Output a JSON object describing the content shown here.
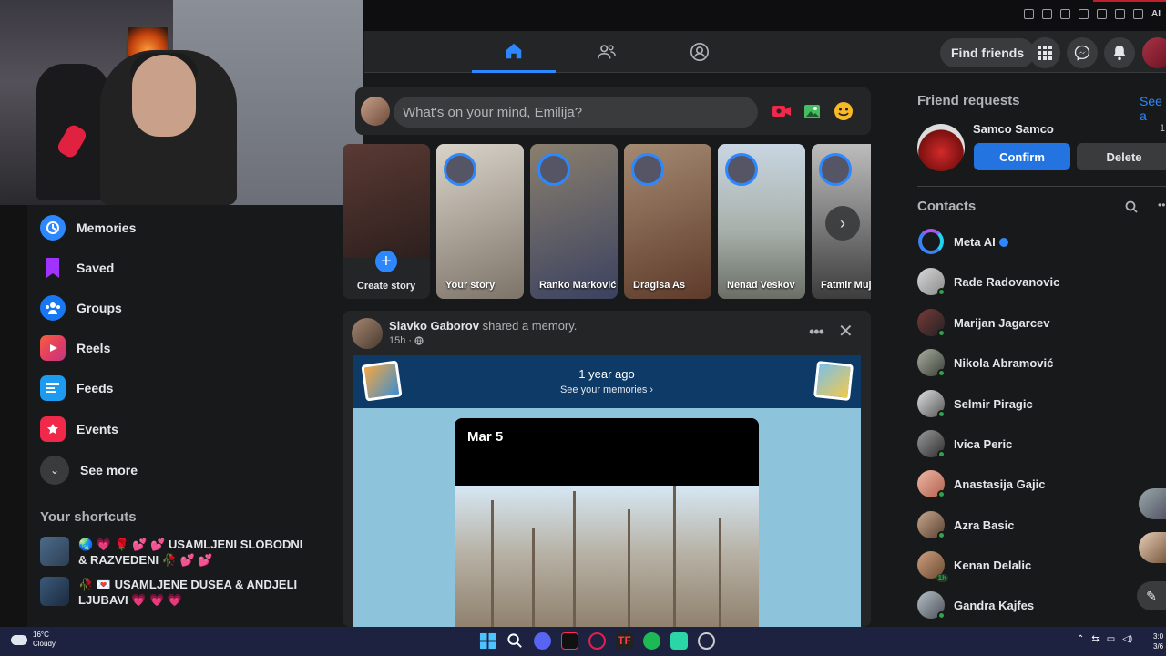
{
  "browser": {
    "extension_label": "AI"
  },
  "topnav": {
    "tabs": [
      {
        "id": "home",
        "icon": "home-icon",
        "active": true
      },
      {
        "id": "friends",
        "icon": "friends-icon",
        "active": false
      },
      {
        "id": "groups",
        "icon": "groups-icon",
        "active": false
      }
    ],
    "find_friends_label": "Find friends",
    "accent": "#2d88ff"
  },
  "sidebar": {
    "items": [
      {
        "label": "Memories",
        "icon": "clock-icon",
        "color": "#2d88ff"
      },
      {
        "label": "Saved",
        "icon": "bookmark-icon",
        "color": "#a033ff"
      },
      {
        "label": "Groups",
        "icon": "groups-icon",
        "color": "#1877f2"
      },
      {
        "label": "Reels",
        "icon": "reels-icon",
        "color": "#e4405f"
      },
      {
        "label": "Feeds",
        "icon": "feeds-icon",
        "color": "#1d9bf0"
      },
      {
        "label": "Events",
        "icon": "calendar-star-icon",
        "color": "#f02849"
      }
    ],
    "see_more_label": "See more",
    "shortcuts_title": "Your shortcuts",
    "shortcuts": [
      {
        "name": "🌏 💗 🌹 💕 💕 USAMLJENI SLOBODNI & RAZVEDENI 🥀 💕 💕"
      },
      {
        "name": "🥀 💌 USAMLJENE DUSEA & ANDJELI LJUBAVI 💗 💗 💗"
      }
    ]
  },
  "composer": {
    "placeholder": "What's on your mind, Emilija?"
  },
  "stories": {
    "create_label": "Create story",
    "items": [
      {
        "name": "Your story"
      },
      {
        "name": "Ranko Marković"
      },
      {
        "name": "Dragisa As"
      },
      {
        "name": "Nenad Veskov"
      },
      {
        "name": "Fatmir Mujo"
      }
    ]
  },
  "post": {
    "author": "Slavko Gaborov",
    "action": "shared a memory.",
    "time": "15h ·",
    "memory_title": "1 year ago",
    "memory_link": "See your memories ›",
    "card_date": "Mar 5"
  },
  "rightrail": {
    "friend_requests_title": "Friend requests",
    "see_all_label": "See a",
    "request": {
      "name": "Samco Samco",
      "count": "1",
      "confirm_label": "Confirm",
      "delete_label": "Delete"
    },
    "contacts_title": "Contacts",
    "contacts": [
      {
        "name": "Meta AI",
        "verified": true,
        "online": false
      },
      {
        "name": "Rade Radovanovic",
        "online": true
      },
      {
        "name": "Marijan Jagarcev",
        "online": true
      },
      {
        "name": "Nikola Abramović",
        "online": true
      },
      {
        "name": "Selmir Piragic",
        "online": true
      },
      {
        "name": "Ivica Peric",
        "online": true
      },
      {
        "name": "Anastasija Gajic",
        "online": true
      },
      {
        "name": "Azra Basic",
        "online": true
      },
      {
        "name": "Kenan Delalic",
        "online": false,
        "badge": "1h"
      },
      {
        "name": "Gandra Kajfes",
        "online": true
      }
    ]
  },
  "taskbar": {
    "temperature": "16°C",
    "weather": "Cloudy",
    "time": "3:0",
    "date": "3/6"
  }
}
